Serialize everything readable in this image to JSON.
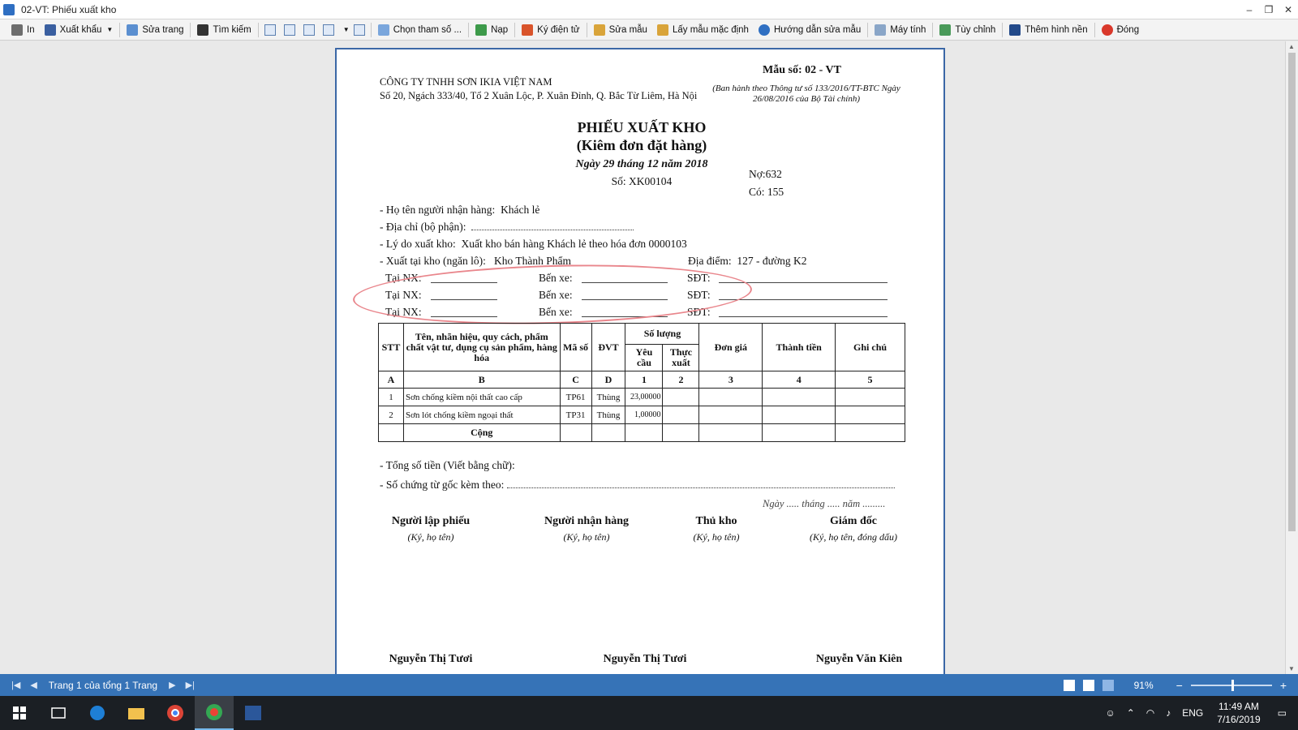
{
  "window": {
    "title": "02-VT: Phiếu xuất kho",
    "minimize": "–",
    "restore": "❐",
    "close": "✕"
  },
  "toolbar": {
    "print": "In",
    "export": "Xuất khẩu",
    "edit_page": "Sửa trang",
    "search": "Tìm kiếm",
    "choose_params": "Chọn tham số ...",
    "load": "Nạp",
    "e_sign": "Ký điện tử",
    "edit_template": "Sửa mẫu",
    "default_template": "Lấy mẫu mặc định",
    "template_help": "Hướng dẫn sửa mẫu",
    "calculator": "Máy tính",
    "customize": "Tùy chỉnh",
    "add_background": "Thêm hình nền",
    "close": "Đóng"
  },
  "document": {
    "company": "CÔNG TY TNHH SƠN IKIA VIỆT NAM",
    "address": "Số 20, Ngách 333/40, Tổ 2 Xuân Lộc, P. Xuân Đỉnh, Q. Bắc Từ Liêm, Hà Nội",
    "form_no": "Mẫu số: 02 - VT",
    "form_issued": "(Ban hành theo Thông tư số 133/2016/TT-BTC Ngày 26/08/2016 của Bộ Tài chính)",
    "title": "PHIẾU XUẤT KHO",
    "subtitle": "(Kiêm đơn đặt hàng)",
    "date": "Ngày 29 tháng 12 năm 2018",
    "number": "Số: XK00104",
    "debit": "Nợ:632",
    "credit": "Có:  155",
    "receiver_label": "- Họ tên người nhận hàng:",
    "receiver_value": "Khách lẻ",
    "address_label": "- Địa chỉ (bộ phận):",
    "reason_label": "- Lý do xuất kho:",
    "reason_value": "Xuất kho bán hàng Khách lẻ theo hóa đơn 0000103",
    "warehouse_label": "- Xuất tại kho (ngăn lô):",
    "warehouse_value": "Kho Thành Phẩm",
    "location_label": "Địa điểm:",
    "location_value": "127 - đường K2",
    "tai_nx": "Tại NX:",
    "ben_xe": "Bến xe:",
    "sdt": "SĐT:",
    "table": {
      "h_stt": "STT",
      "h_name": "Tên, nhãn hiệu, quy cách, phẩm chất vật tư, dụng cụ sản phẩm, hàng hóa",
      "h_code": "Mã số",
      "h_unit": "ĐVT",
      "h_qty": "Số lượng",
      "h_req": "Yêu cầu",
      "h_actual": "Thực xuất",
      "h_price": "Đơn giá",
      "h_amount": "Thành tiền",
      "h_note": "Ghi chú",
      "idx": [
        "A",
        "B",
        "C",
        "D",
        "1",
        "2",
        "3",
        "4",
        "5"
      ],
      "rows": [
        {
          "stt": "1",
          "name": "Sơn chống kiềm nội thất cao cấp",
          "code": "TP61",
          "unit": "Thùng",
          "req": "23,00000"
        },
        {
          "stt": "2",
          "name": "Sơn lót chống kiềm ngoại thất",
          "code": "TP31",
          "unit": "Thùng",
          "req": "1,00000"
        }
      ],
      "total": "Cộng"
    },
    "total_words": "- Tổng số tiền (Viết bằng chữ):",
    "attached_docs": "- Số chứng từ gốc kèm theo:",
    "date_blank": "Ngày ..... tháng ..... năm .........",
    "signers": [
      {
        "title": "Người lập phiếu",
        "note": "(Ký, họ tên)",
        "name": "Nguyễn Thị Tươi"
      },
      {
        "title": "Người nhận hàng",
        "note": "(Ký, họ tên)",
        "name": "Nguyễn Thị Tươi"
      },
      {
        "title": "Thủ kho",
        "note": "(Ký, họ tên)",
        "name": ""
      },
      {
        "title": "Giám đốc",
        "note": "(Ký, họ tên, đóng dấu)",
        "name": "Nguyễn Văn Kiên"
      }
    ]
  },
  "statusbar": {
    "page_info": "Trang 1 của tổng 1 Trang",
    "zoom": "91%"
  },
  "taskbar": {
    "language": "ENG",
    "time": "11:49 AM",
    "date": "7/16/2019"
  },
  "colors": {
    "accent": "#3673b7",
    "circle_mark": "#e9868c",
    "taskbar": "#1b1f24"
  }
}
